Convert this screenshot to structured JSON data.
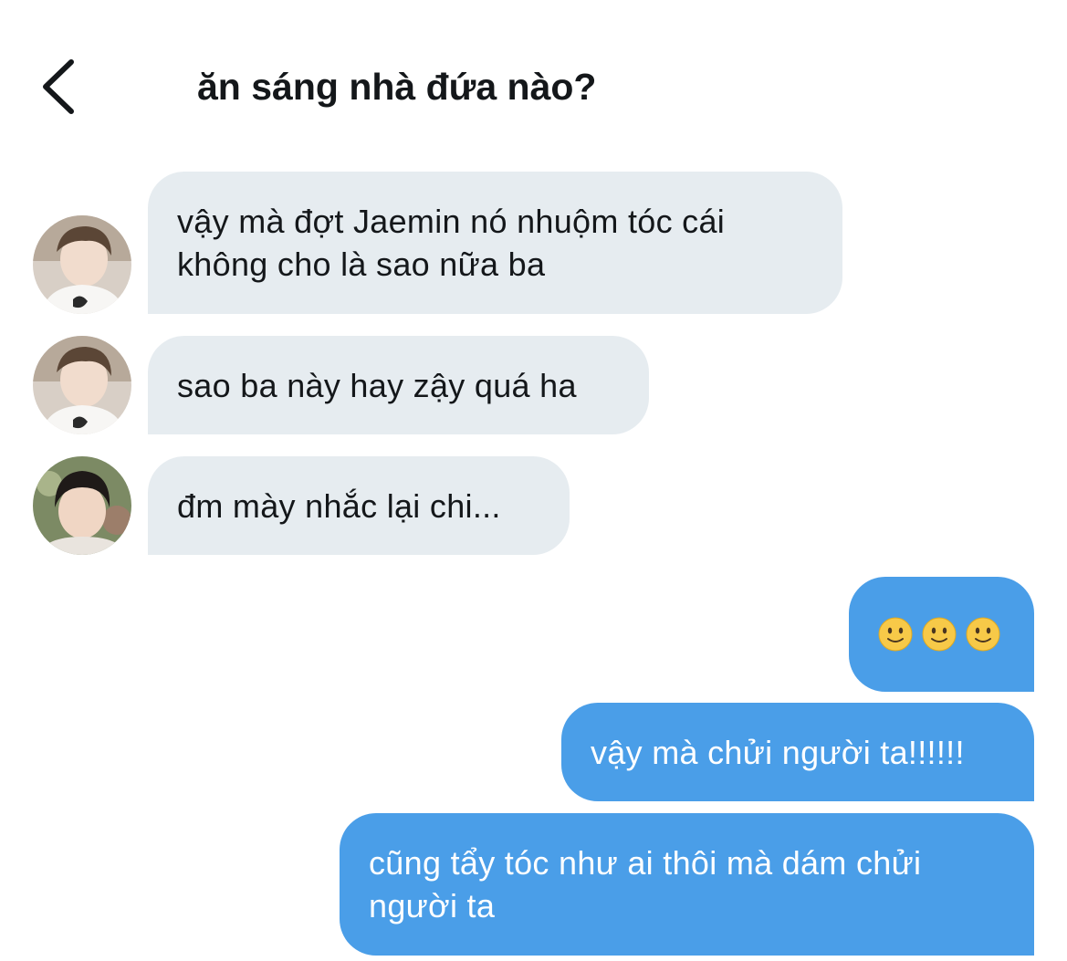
{
  "header": {
    "title": "ăn sáng nhà đứa nào?",
    "back_icon": "chevron-left-icon"
  },
  "messages": [
    {
      "direction": "incoming",
      "avatar": "avatar-boy-white-shirt",
      "text": "vậy mà đợt Jaemin nó nhuộm tóc cái\nkhông cho là sao nữa ba"
    },
    {
      "direction": "incoming",
      "avatar": "avatar-boy-white-shirt",
      "text": "sao ba này hay zậy quá ha"
    },
    {
      "direction": "incoming",
      "avatar": "avatar-boy-dark-hair",
      "text": "đm mày nhắc lại chi..."
    },
    {
      "direction": "outgoing",
      "emoji": [
        "slightly-smiling-face",
        "slightly-smiling-face",
        "slightly-smiling-face"
      ]
    },
    {
      "direction": "outgoing",
      "text": "vậy mà chửi người ta!!!!!!"
    },
    {
      "direction": "outgoing",
      "text": "cũng tẩy tóc như ai thôi mà dám chửi\nngười ta"
    }
  ],
  "colors": {
    "incoming_bubble": "#e6ecf0",
    "outgoing_bubble": "#4a9ee8",
    "text_dark": "#14171a",
    "text_light": "#ffffff"
  }
}
